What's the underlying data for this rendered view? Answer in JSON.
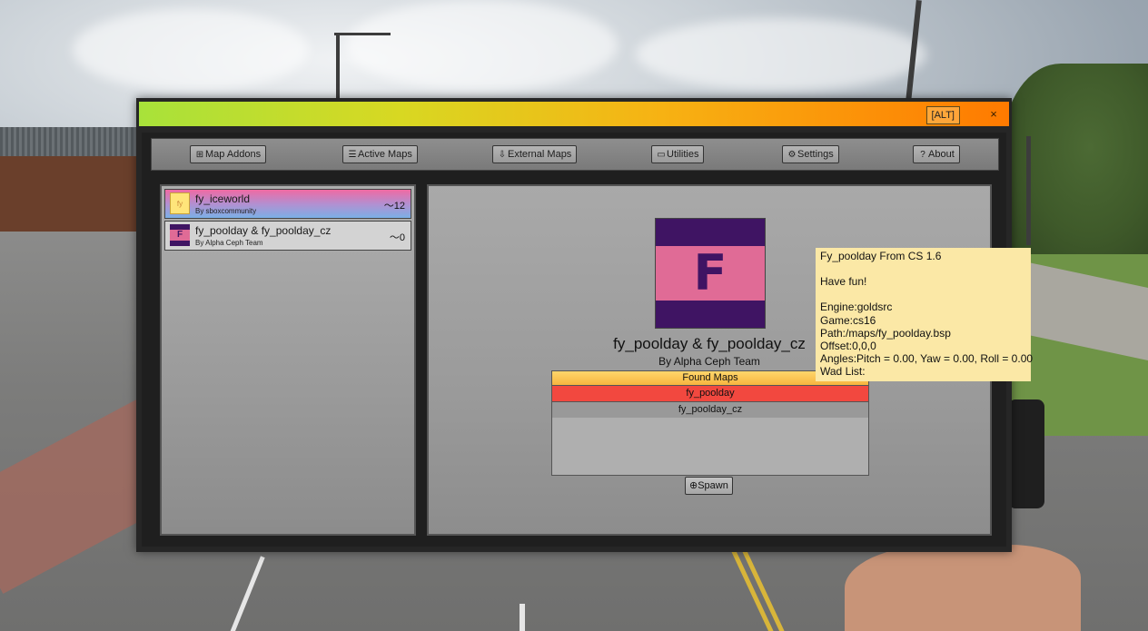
{
  "window": {
    "alt_badge": "[ALT]",
    "close_icon": "×"
  },
  "toolbar": {
    "buttons": [
      {
        "label": "Map Addons",
        "icon": "grid-icon"
      },
      {
        "label": "Active Maps",
        "icon": "list-icon"
      },
      {
        "label": "External Maps",
        "icon": "import-icon"
      },
      {
        "label": "Utilities",
        "icon": "keyboard-icon"
      },
      {
        "label": "Settings",
        "icon": "gear-icon"
      },
      {
        "label": "About",
        "icon": "question-icon"
      }
    ]
  },
  "map_list": [
    {
      "name": "fy_iceworld",
      "author": "By sboxcommunity",
      "stat": "12",
      "thumb_text": "fy",
      "active": true
    },
    {
      "name": "fy_poolday & fy_poolday_cz",
      "author": "By Alpha Ceph Team",
      "stat": "0",
      "thumb_text": "F",
      "active": false
    }
  ],
  "detail": {
    "thumb_letter": "F",
    "title": "fy_poolday & fy_poolday_cz",
    "author": "By Alpha Ceph Team",
    "found_header": "Found Maps",
    "found_items": [
      "fy_poolday",
      "fy_poolday_cz"
    ],
    "spawn_label": "Spawn"
  },
  "tooltip": {
    "line1": "Fy_poolday From CS 1.6",
    "line2": "Have fun!",
    "engine": "Engine:goldsrc",
    "game": "Game:cs16",
    "path": "Path:/maps/fy_poolday.bsp",
    "offset": "Offset:0,0,0",
    "angles": "Angles:Pitch = 0.00, Yaw = 0.00, Roll = 0.00",
    "wad": "Wad List:"
  },
  "colors": {
    "title_gradient": [
      "#a8e23a",
      "#f7b213",
      "#ff7a00"
    ],
    "active_item_gradient": [
      "#f06aa3",
      "#7bb0e6"
    ],
    "poolday_purple": "#3f1463",
    "poolday_pink": "#e06b96",
    "selected_row": "#f2483f",
    "found_header": "#f7b53f",
    "tooltip_bg": "#fbe8a6"
  }
}
